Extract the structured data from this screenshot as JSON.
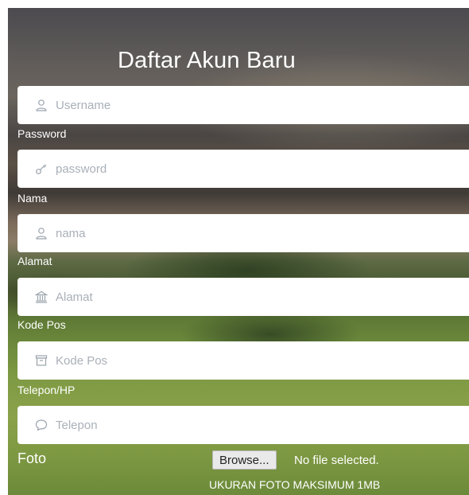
{
  "form": {
    "title": "Daftar Akun Baru",
    "fields": [
      {
        "label": "",
        "placeholder": "Username",
        "icon": "user-icon",
        "value": ""
      },
      {
        "label": "Password",
        "placeholder": "password",
        "icon": "key-icon",
        "value": ""
      },
      {
        "label": "Nama",
        "placeholder": "nama",
        "icon": "user-icon",
        "value": ""
      },
      {
        "label": "Alamat",
        "placeholder": "Alamat",
        "icon": "bank-icon",
        "value": ""
      },
      {
        "label": "Kode Pos",
        "placeholder": "Kode Pos",
        "icon": "archive-icon",
        "value": ""
      },
      {
        "label": "Telepon/HP",
        "placeholder": "Telepon",
        "icon": "chat-icon",
        "value": ""
      }
    ],
    "foto": {
      "label": "Foto",
      "browse_label": "Browse...",
      "file_status": "No file selected.",
      "note": "UKURAN FOTO MAKSIMUM 1MB"
    }
  },
  "colors": {
    "label_text": "#ffffff",
    "input_bg": "#ffffff",
    "placeholder": "#a9b0b8",
    "icon": "#9aa3ad"
  }
}
